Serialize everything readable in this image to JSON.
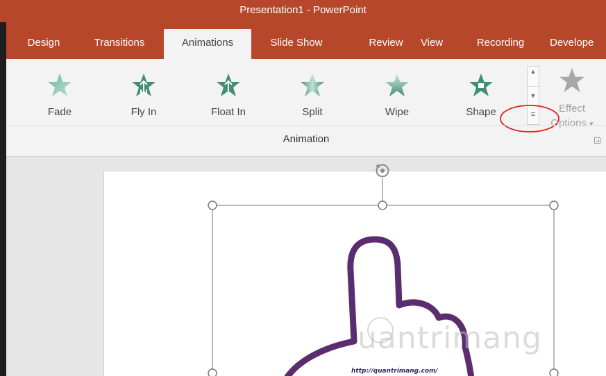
{
  "window": {
    "title": "Presentation1  -  PowerPoint"
  },
  "tabs": [
    {
      "label": "Design"
    },
    {
      "label": "Transitions"
    },
    {
      "label": "Animations",
      "active": true
    },
    {
      "label": "Slide Show"
    },
    {
      "label": "Review"
    },
    {
      "label": "View"
    },
    {
      "label": "Recording"
    },
    {
      "label": "Develope"
    }
  ],
  "animations": [
    {
      "label": "Fade",
      "icon": "star-fade-icon"
    },
    {
      "label": "Fly In",
      "icon": "star-fly-in-icon"
    },
    {
      "label": "Float In",
      "icon": "star-float-in-icon"
    },
    {
      "label": "Split",
      "icon": "star-split-icon"
    },
    {
      "label": "Wipe",
      "icon": "star-wipe-icon"
    },
    {
      "label": "Shape",
      "icon": "star-shape-icon"
    }
  ],
  "effect_options": {
    "line1": "Effect",
    "line2": "Options",
    "arrow": "▾"
  },
  "group_label": "Animation",
  "slide": {
    "url_text": "http://quantrimang.com/",
    "watermark": "uantrimang"
  },
  "colors": {
    "accent": "#b7472a",
    "star": "#4a9a80",
    "hand": "#5b2d6e",
    "highlight": "#e02020"
  }
}
